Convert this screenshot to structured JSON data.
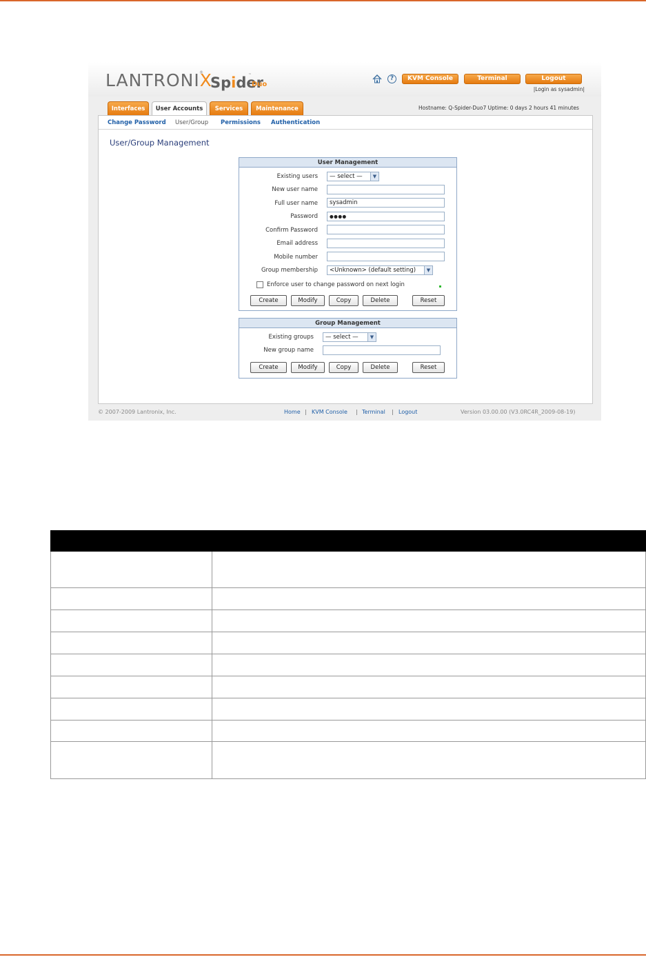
{
  "header": {
    "brand": "LANTRONI",
    "brand_x": "X",
    "brand_reg": "®",
    "product_pre": "Sp",
    "product_i": "i",
    "product_post": "der",
    "product_tm": "™",
    "product_sub": "Duo",
    "kvm_console": "KVM Console",
    "terminal": "Terminal",
    "logout": "Logout",
    "login_as": "|Login as sysadmin|",
    "hostinfo": "Hostname: Q-Spider-Duo7   Uptime: 0 days 2 hours 41 minutes"
  },
  "tabs": [
    {
      "label": "Interfaces",
      "active": false
    },
    {
      "label": "User Accounts",
      "active": true
    },
    {
      "label": "Services",
      "active": false
    },
    {
      "label": "Maintenance",
      "active": false
    }
  ],
  "subnav": {
    "change_password": "Change Password",
    "user_group": "User/Group",
    "permissions": "Permissions",
    "authentication": "Authentication"
  },
  "page_title": "User/Group Management",
  "user_mgmt": {
    "title": "User Management",
    "existing_users_label": "Existing users",
    "existing_users_value": "— select —",
    "new_user_name_label": "New user name",
    "new_user_name_value": "",
    "full_user_name_label": "Full user name",
    "full_user_name_value": "sysadmin",
    "password_label": "Password",
    "password_value": "●●●●",
    "confirm_password_label": "Confirm Password",
    "confirm_password_value": "",
    "email_label": "Email address",
    "email_value": "",
    "mobile_label": "Mobile number",
    "mobile_value": "",
    "group_label": "Group membership",
    "group_value": "<Unknown> (default setting)",
    "enforce_label": "Enforce user to change password on next login",
    "create": "Create",
    "modify": "Modify",
    "copy": "Copy",
    "delete": "Delete",
    "reset": "Reset"
  },
  "group_mgmt": {
    "title": "Group Management",
    "existing_groups_label": "Existing groups",
    "existing_groups_value": "— select —",
    "new_group_name_label": "New group name",
    "new_group_name_value": "",
    "create": "Create",
    "modify": "Modify",
    "copy": "Copy",
    "delete": "Delete",
    "reset": "Reset"
  },
  "footer": {
    "copyright": "© 2007-2009 Lantronix, Inc.",
    "home": "Home",
    "kvm_console": "KVM Console",
    "terminal": "Terminal",
    "logout": "Logout",
    "sep": "|",
    "version": "Version 03.00.00 (V3.0RC4R_2009-08-19)"
  }
}
